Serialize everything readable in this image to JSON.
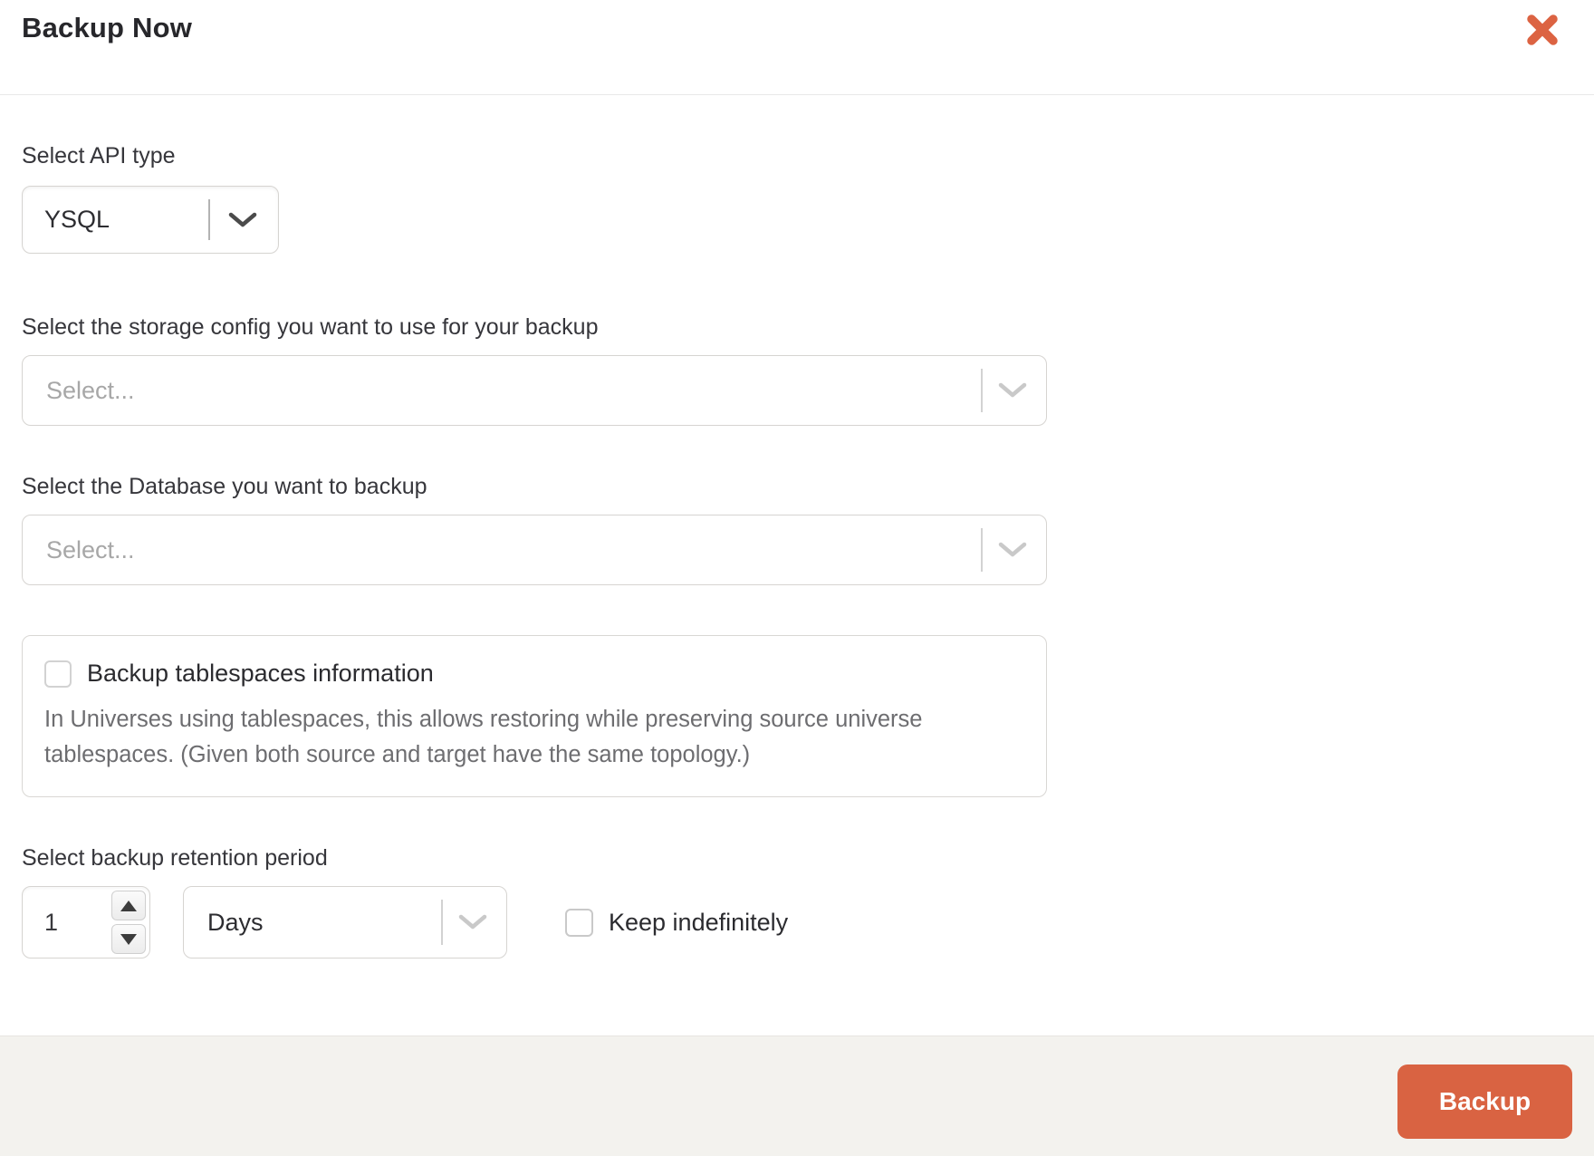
{
  "header": {
    "title": "Backup Now"
  },
  "form": {
    "api_type": {
      "label": "Select API type",
      "value": "YSQL"
    },
    "storage_config": {
      "label": "Select the storage config you want to use for your backup",
      "placeholder": "Select..."
    },
    "database": {
      "label": "Select the Database you want to backup",
      "placeholder": "Select..."
    },
    "tablespaces": {
      "label": "Backup tablespaces information",
      "checked": false,
      "description": "In Universes using tablespaces, this allows restoring while preserving source universe tablespaces. (Given both source and target have the same topology.)"
    },
    "retention": {
      "label": "Select backup retention period",
      "value": "1",
      "unit_value": "Days",
      "keep_label": "Keep indefinitely",
      "keep_checked": false
    }
  },
  "footer": {
    "backup_label": "Backup"
  },
  "icons": {
    "close": "heavy-x",
    "chevron_down": "chevron-down",
    "spin_up": "triangle-up",
    "spin_down": "triangle-down"
  },
  "colors": {
    "accent_orange": "#DC6342",
    "button_orange": "#D96342",
    "footer_bg": "#F3F2EE",
    "border_gray": "#D6D4D1",
    "placeholder_gray": "#A7A7A7"
  }
}
